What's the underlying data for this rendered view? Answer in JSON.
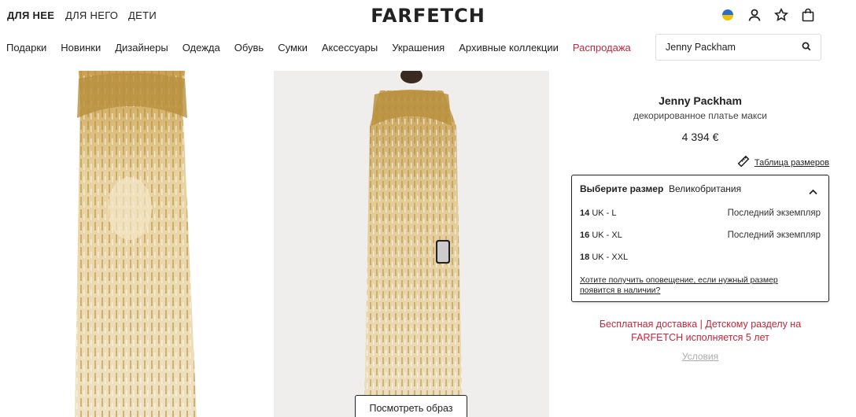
{
  "header": {
    "genders": [
      "ДЛЯ НЕЕ",
      "ДЛЯ НЕГО",
      "ДЕТИ"
    ],
    "logo": "FARFETCH",
    "icons": [
      "ukraine-flag-icon",
      "account-icon",
      "wishlist-star-icon",
      "shopping-bag-icon"
    ]
  },
  "nav": {
    "items": [
      "Подарки",
      "Новинки",
      "Дизайнеры",
      "Одежда",
      "Обувь",
      "Сумки",
      "Аксессуары",
      "Украшения",
      "Архивные коллекции"
    ],
    "sale": "Распродажа"
  },
  "search": {
    "value": "Jenny Packham"
  },
  "gallery": {
    "view_look_label": "Посмотреть образ"
  },
  "product": {
    "brand": "Jenny Packham",
    "name": "декорированное платье макси",
    "price": "4 394 €",
    "size_chart": "Таблица размеров"
  },
  "size_selector": {
    "label": "Выберите размер",
    "region": "Великобритания",
    "options": [
      {
        "num": "14",
        "label": "UK - L",
        "stock": "Последний экземпляр"
      },
      {
        "num": "16",
        "label": "UK - XL",
        "stock": "Последний экземпляр"
      },
      {
        "num": "18",
        "label": "UK - XXL",
        "stock": ""
      }
    ],
    "notify": "Хотите получить оповещение, если нужный размер появится в наличии?"
  },
  "promo": {
    "text": "Бесплатная доставка  |  Детскому разделу на FARFETCH исполняется 5 лет",
    "terms": "Условия"
  },
  "colors": {
    "sale": "#c2283b",
    "gold": "#d8b66a"
  }
}
